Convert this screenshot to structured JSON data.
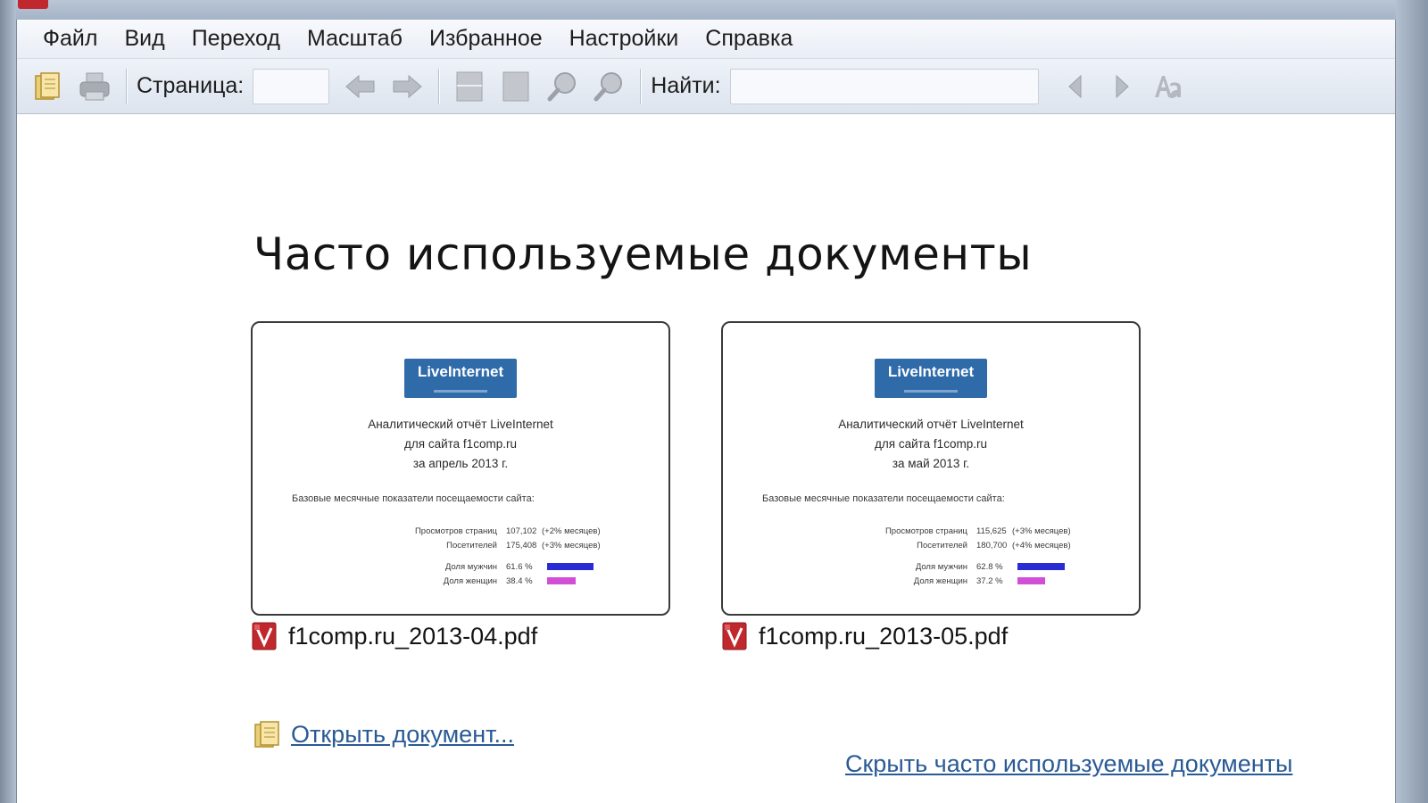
{
  "menu": [
    "Файл",
    "Вид",
    "Переход",
    "Масштаб",
    "Избранное",
    "Настройки",
    "Справка"
  ],
  "toolbar": {
    "page_label": "Страница:",
    "page_value": "",
    "find_label": "Найти:",
    "find_value": "",
    "icons": [
      "open-icon",
      "print-icon",
      "back-arrow-icon",
      "forward-arrow-icon",
      "fit-page-icon",
      "fit-width-icon",
      "zoom-in-icon",
      "zoom-out-icon",
      "find-prev-icon",
      "find-next-icon",
      "match-case-icon"
    ]
  },
  "main": {
    "title": "Часто используемые документы",
    "documents": [
      {
        "filename": "f1comp.ru_2013-04.pdf",
        "thumb": {
          "logo": "LiveInternet",
          "line1": "Аналитический отчёт LiveInternet",
          "line2": "для сайта f1comp.ru",
          "line3": "за апрель 2013 г.",
          "base": "Базовые месячные показатели посещаемости сайта:",
          "stats": [
            {
              "label": "Просмотров страниц",
              "value": "107,102",
              "note": "(+2% месяцев)"
            },
            {
              "label": "Посетителей",
              "value": "175,408",
              "note": "(+3% месяцев)"
            }
          ],
          "shares": [
            {
              "label": "Доля мужчин",
              "value": "61.6 %",
              "fraction": 0.616
            },
            {
              "label": "Доля женщин",
              "value": "38.4 %",
              "fraction": 0.384
            }
          ]
        }
      },
      {
        "filename": "f1comp.ru_2013-05.pdf",
        "thumb": {
          "logo": "LiveInternet",
          "line1": "Аналитический отчёт LiveInternet",
          "line2": "для сайта f1comp.ru",
          "line3": "за май 2013 г.",
          "base": "Базовые месячные показатели посещаемости сайта:",
          "stats": [
            {
              "label": "Просмотров страниц",
              "value": "115,625",
              "note": "(+3% месяцев)"
            },
            {
              "label": "Посетителей",
              "value": "180,700",
              "note": "(+4% месяцев)"
            }
          ],
          "shares": [
            {
              "label": "Доля мужчин",
              "value": "62.8 %",
              "fraction": 0.628
            },
            {
              "label": "Доля женщин",
              "value": "37.2 %",
              "fraction": 0.372
            }
          ]
        }
      }
    ],
    "open_document": "Открыть документ...",
    "hide_frequent": "Скрыть часто используемые документы"
  },
  "colors": {
    "link": "#2a5a96",
    "logo_blue": "#2f6aa9",
    "bar_men": "#2b2bd6",
    "bar_women": "#d14fd6",
    "pdf_red": "#c0282d"
  }
}
